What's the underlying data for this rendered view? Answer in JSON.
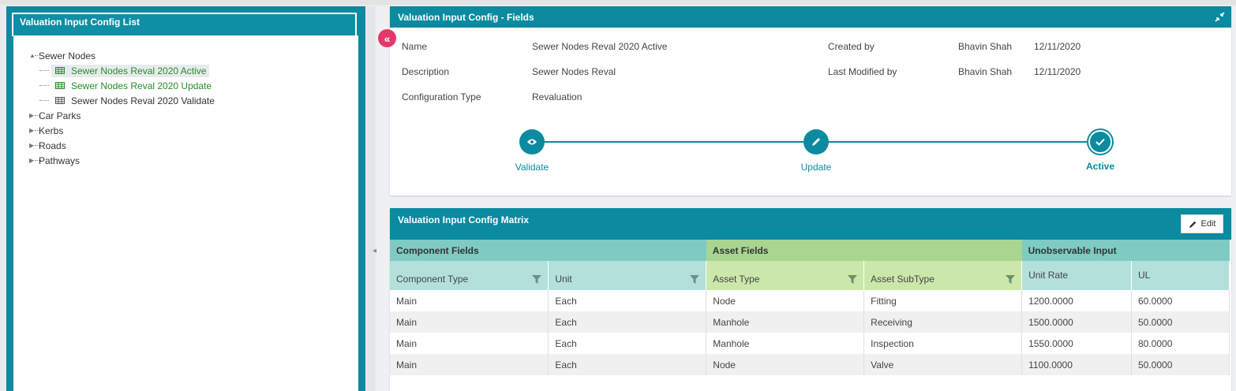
{
  "left_panel": {
    "title": "Valuation Input Config List",
    "tree": [
      {
        "label": "Sewer Nodes",
        "expanded": true,
        "children": [
          {
            "label": "Sewer Nodes Reval 2020 Active",
            "status": "green",
            "selected": true
          },
          {
            "label": "Sewer Nodes Reval 2020 Update",
            "status": "green",
            "selected": false
          },
          {
            "label": "Sewer Nodes Reval 2020 Validate",
            "status": "normal",
            "selected": false
          }
        ]
      },
      {
        "label": "Car Parks",
        "expanded": false
      },
      {
        "label": "Kerbs",
        "expanded": false
      },
      {
        "label": "Roads",
        "expanded": false
      },
      {
        "label": "Pathways",
        "expanded": false
      }
    ]
  },
  "fields_panel": {
    "title": "Valuation Input Config - Fields",
    "name_label": "Name",
    "name_value": "Sewer Nodes Reval 2020 Active",
    "description_label": "Description",
    "description_value": "Sewer Nodes Reval",
    "config_type_label": "Configuration Type",
    "config_type_value": "Revaluation",
    "created_by_label": "Created by",
    "created_by_user": "Bhavin Shah",
    "created_by_date": "12/11/2020",
    "modified_by_label": "Last Modified by",
    "modified_by_user": "Bhavin Shah",
    "modified_by_date": "12/11/2020"
  },
  "stepper": {
    "steps": [
      {
        "label": "Validate",
        "icon": "eye-icon"
      },
      {
        "label": "Update",
        "icon": "pencil-icon"
      },
      {
        "label": "Active",
        "icon": "check-icon",
        "active": true
      }
    ]
  },
  "matrix": {
    "title": "Valuation Input Config Matrix",
    "edit_label": "Edit",
    "groups": [
      "Component Fields",
      "Asset Fields",
      "Unobservable Input"
    ],
    "columns": [
      "Component Type",
      "Unit",
      "Asset Type",
      "Asset SubType",
      "Unit Rate",
      "UL"
    ],
    "rows": [
      [
        "Main",
        "Each",
        "Node",
        "Fitting",
        "1200.0000",
        "60.0000"
      ],
      [
        "Main",
        "Each",
        "Manhole",
        "Receiving",
        "1500.0000",
        "50.0000"
      ],
      [
        "Main",
        "Each",
        "Manhole",
        "Inspection",
        "1550.0000",
        "80.0000"
      ],
      [
        "Main",
        "Each",
        "Node",
        "Valve",
        "1100.0000",
        "50.0000"
      ]
    ]
  },
  "colors": {
    "accent": "#0b8aa0",
    "collapse_button": "#e3386a",
    "tree_green": "#2a8a2a"
  }
}
